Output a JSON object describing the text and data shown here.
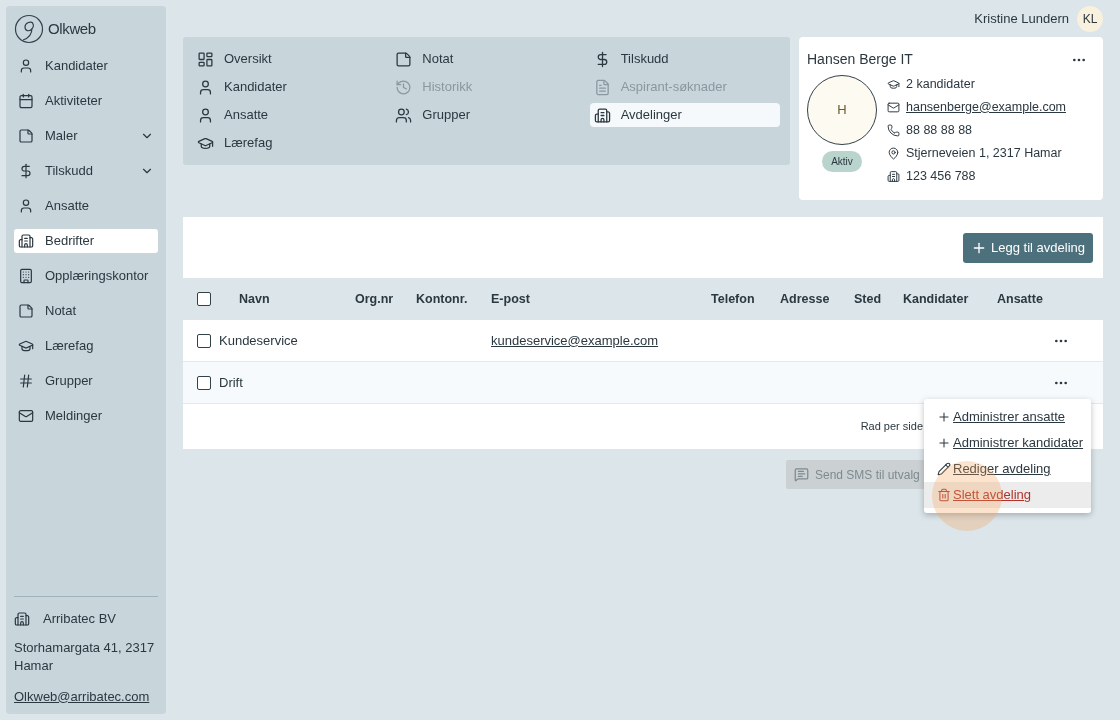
{
  "brand": {
    "name": "Olkweb"
  },
  "user": {
    "name": "Kristine Lundern",
    "initials": "KL"
  },
  "sidebar": {
    "items": [
      {
        "label": "Kandidater",
        "selected": false
      },
      {
        "label": "Aktiviteter",
        "selected": false
      },
      {
        "label": "Maler",
        "selected": false,
        "expanded": false
      },
      {
        "label": "Tilskudd",
        "selected": false,
        "expanded": false
      },
      {
        "label": "Ansatte",
        "selected": false
      },
      {
        "label": "Bedrifter",
        "selected": true
      },
      {
        "label": "Opplæringskontor",
        "selected": false
      },
      {
        "label": "Notat",
        "selected": false
      },
      {
        "label": "Lærefag",
        "selected": false
      },
      {
        "label": "Grupper",
        "selected": false
      },
      {
        "label": "Meldinger",
        "selected": false
      }
    ],
    "footer": {
      "company": "Arribatec BV",
      "address": "Storhamargata 41, 2317 Hamar",
      "email": "Olkweb@arribatec.com"
    }
  },
  "nav": {
    "columns": [
      [
        {
          "label": "Oversikt",
          "selected": false,
          "disabled": false
        },
        {
          "label": "Kandidater",
          "selected": false,
          "disabled": false
        },
        {
          "label": "Ansatte",
          "selected": false,
          "disabled": false
        },
        {
          "label": "Lærefag",
          "selected": false,
          "disabled": false
        }
      ],
      [
        {
          "label": "Notat",
          "selected": false,
          "disabled": false
        },
        {
          "label": "Historikk",
          "selected": false,
          "disabled": true
        },
        {
          "label": "Grupper",
          "selected": false,
          "disabled": false
        }
      ],
      [
        {
          "label": "Tilskudd",
          "selected": false,
          "disabled": false
        },
        {
          "label": "Aspirant-søknader",
          "selected": false,
          "disabled": true
        },
        {
          "label": "Avdelinger",
          "selected": true,
          "disabled": false
        }
      ]
    ]
  },
  "company_card": {
    "name": "Hansen Berge IT",
    "avatar": "H",
    "status": "Aktiv",
    "candidates": "2 kandidater",
    "email": "hansenberge@example.com",
    "phone": "88 88 88 88",
    "address": "Stjerneveien 1, 2317 Hamar",
    "org_number": "123 456 788"
  },
  "add_button": "Legg til avdeling",
  "table": {
    "columns": [
      "Navn",
      "Org.nr",
      "Kontonr.",
      "E-post",
      "Telefon",
      "Adresse",
      "Sted",
      "Kandidater",
      "Ansatte"
    ],
    "header_checked": false,
    "rows": [
      {
        "checked": false,
        "name": "Kundeservice",
        "email": "kundeservice@example.com"
      },
      {
        "checked": false,
        "name": "Drift"
      }
    ],
    "rows_per_page_label": "Rad per side"
  },
  "sms_button": {
    "label": "Send SMS til utvalg",
    "disabled": true
  },
  "row_menu": {
    "items": [
      {
        "kind": "add",
        "label": "Administrer ansatte",
        "selected": false
      },
      {
        "kind": "add",
        "label": "Administrer kandidater",
        "selected": false
      },
      {
        "kind": "edit",
        "label": "Rediger avdeling",
        "selected": false
      },
      {
        "kind": "delete",
        "label": "Slett avdeling",
        "selected": true
      }
    ]
  }
}
